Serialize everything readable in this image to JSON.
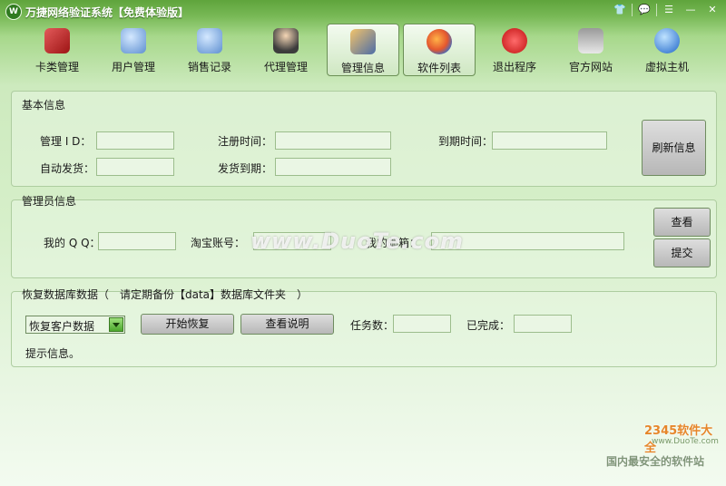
{
  "window": {
    "title": "万捷网络验证系统【免费体验版】"
  },
  "toolbar": {
    "items": [
      {
        "label": "卡类管理",
        "icon": "card-icon",
        "active": false
      },
      {
        "label": "用户管理",
        "icon": "users-icon",
        "active": false
      },
      {
        "label": "销售记录",
        "icon": "sales-icon",
        "active": false
      },
      {
        "label": "代理管理",
        "icon": "agent-icon",
        "active": false
      },
      {
        "label": "管理信息",
        "icon": "manage-house-icon",
        "active": true
      },
      {
        "label": "软件列表",
        "icon": "software-list-icon",
        "active": true
      },
      {
        "label": "退出程序",
        "icon": "power-icon",
        "active": false
      },
      {
        "label": "官方网站",
        "icon": "home-icon",
        "active": false
      },
      {
        "label": "虚拟主机",
        "icon": "globe-icon",
        "active": false
      }
    ]
  },
  "basic_info": {
    "title": "基本信息",
    "admin_id_label": "管理 I D：",
    "reg_time_label": "注册时间：",
    "expire_time_label": "到期时间：",
    "auto_ship_label": "自动发货：",
    "ship_expire_label": "发货到期：",
    "refresh_button": "刷新信息"
  },
  "admin_info": {
    "title": "管理员信息",
    "qq_label": "我的 Q Q：",
    "taobao_label": "淘宝账号：",
    "email_label": "我的邮箱：",
    "view_button": "查看",
    "submit_button": "提交"
  },
  "restore": {
    "title": "恢复数据库数据（　请定期备份【data】数据库文件夹　）",
    "select_value": "恢复客户数据",
    "start_button": "开始恢复",
    "help_button": "查看说明",
    "task_count_label": "任务数：",
    "done_label": "已完成：",
    "hint": "提示信息。"
  },
  "watermark": "www.DuoTe.com",
  "brand": {
    "name": "2345软件大全",
    "url": "www.DuoTe.com",
    "slogan": "国内最安全的软件站"
  },
  "colors": {
    "accent": "#5fa43c",
    "panel": "#e8f6e2",
    "field": "#eaf6e4"
  }
}
